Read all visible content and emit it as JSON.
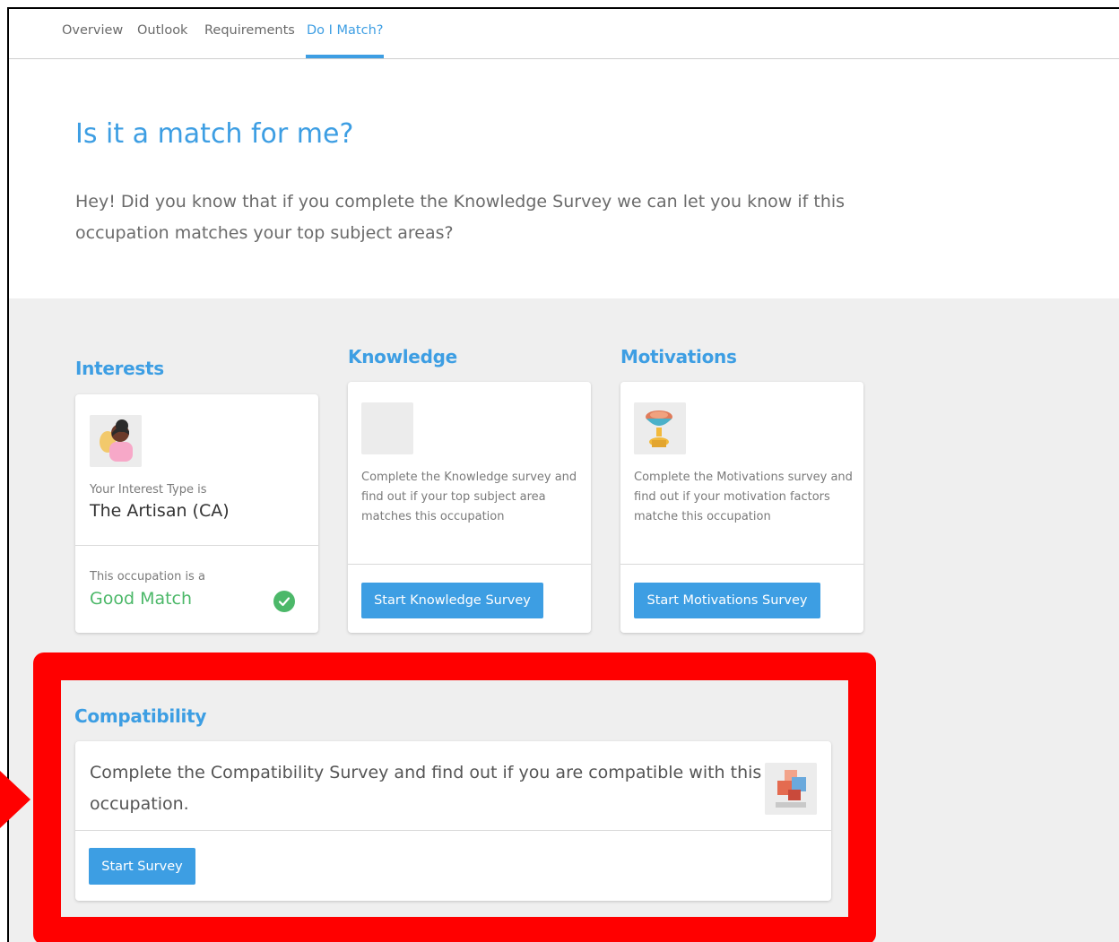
{
  "tabs": [
    {
      "label": "Overview",
      "active": false
    },
    {
      "label": "Outlook",
      "active": false
    },
    {
      "label": "Requirements",
      "active": false
    },
    {
      "label": "Do I Match?",
      "active": true
    }
  ],
  "hero": {
    "title": "Is it a match for me?",
    "text": "Hey! Did you know that if you complete the Knowledge Survey we can let you know if this occupation matches your top subject areas?"
  },
  "interests": {
    "heading": "Interests",
    "type_label": "Your Interest Type is",
    "type_value": "The Artisan (CA)",
    "match_label": "This occupation is a",
    "match_value": "Good Match",
    "icon": "artisan-avatar-icon"
  },
  "knowledge": {
    "heading": "Knowledge",
    "description": "Complete the Knowledge survey and find out if your top subject area matches this occupation",
    "button": "Start Knowledge Survey"
  },
  "motivations": {
    "heading": "Motivations",
    "description": "Complete the Motivations survey and find out if your motivation factors matche this occupation",
    "button": "Start Motivations Survey",
    "icon": "trophy-icon"
  },
  "compatibility": {
    "heading": "Compatibility",
    "description": "Complete the Compatibility Survey and find out if you are compatible with this occupation.",
    "button": "Start Survey",
    "icon": "puzzle-icon"
  },
  "colors": {
    "accent": "#3d9ee3",
    "success": "#4cb869",
    "highlight": "#ff0000",
    "section_bg": "#efefef"
  }
}
